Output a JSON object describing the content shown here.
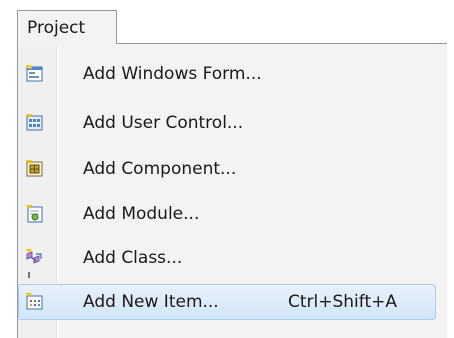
{
  "menu": {
    "title": "Project"
  },
  "items": [
    {
      "label": "Add Windows Form...",
      "icon": "windows-form-icon",
      "shortcut": ""
    },
    {
      "label": "Add User Control...",
      "icon": "user-control-icon",
      "shortcut": ""
    },
    {
      "label": "Add Component...",
      "icon": "component-icon",
      "shortcut": ""
    },
    {
      "label": "Add Module...",
      "icon": "module-icon",
      "shortcut": ""
    },
    {
      "label": "Add Class...",
      "icon": "class-icon",
      "shortcut": ""
    },
    {
      "label": "Add New Item...",
      "icon": "new-item-icon",
      "shortcut": "Ctrl+Shift+A",
      "highlighted": true
    }
  ],
  "colors": {
    "menu_background": "#f3f3f3",
    "highlight_border": "#a8cdf1",
    "highlight_fill": "#d3e5f9"
  }
}
